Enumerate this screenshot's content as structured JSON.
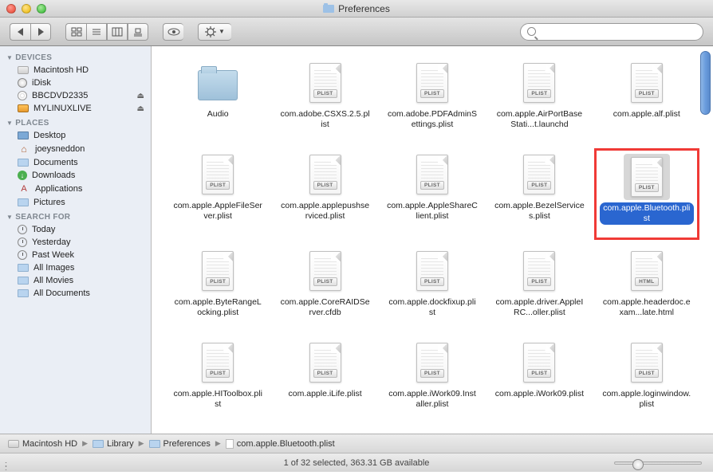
{
  "window": {
    "title": "Preferences"
  },
  "search": {
    "placeholder": ""
  },
  "sidebar": {
    "sections": [
      {
        "header": "DEVICES",
        "items": [
          {
            "label": "Macintosh HD",
            "icon": "drive",
            "eject": false
          },
          {
            "label": "iDisk",
            "icon": "idisk",
            "eject": false
          },
          {
            "label": "BBCDVD2335",
            "icon": "disc",
            "eject": true
          },
          {
            "label": "MYLINUXLIVE",
            "icon": "ext",
            "eject": true
          }
        ]
      },
      {
        "header": "PLACES",
        "items": [
          {
            "label": "Desktop",
            "icon": "desk"
          },
          {
            "label": "joeysneddon",
            "icon": "home"
          },
          {
            "label": "Documents",
            "icon": "folder"
          },
          {
            "label": "Downloads",
            "icon": "dl"
          },
          {
            "label": "Applications",
            "icon": "app"
          },
          {
            "label": "Pictures",
            "icon": "folder"
          }
        ]
      },
      {
        "header": "SEARCH FOR",
        "items": [
          {
            "label": "Today",
            "icon": "clock"
          },
          {
            "label": "Yesterday",
            "icon": "clock"
          },
          {
            "label": "Past Week",
            "icon": "clock"
          },
          {
            "label": "All Images",
            "icon": "img"
          },
          {
            "label": "All Movies",
            "icon": "img"
          },
          {
            "label": "All Documents",
            "icon": "img"
          }
        ]
      }
    ]
  },
  "files": [
    {
      "name": "Audio",
      "type": "folder",
      "badge": ""
    },
    {
      "name": "com.adobe.CSXS.2.5.plist",
      "type": "doc",
      "badge": "PLIST"
    },
    {
      "name": "com.adobe.PDFAdminSettings.plist",
      "type": "doc",
      "badge": "PLIST"
    },
    {
      "name": "com.apple.AirPortBaseStati...t.launchd",
      "type": "doc",
      "badge": "PLIST"
    },
    {
      "name": "com.apple.alf.plist",
      "type": "doc",
      "badge": "PLIST"
    },
    {
      "name": "com.apple.AppleFileServer.plist",
      "type": "doc",
      "badge": "PLIST"
    },
    {
      "name": "com.apple.applepushserviced.plist",
      "type": "doc",
      "badge": "PLIST"
    },
    {
      "name": "com.apple.AppleShareClient.plist",
      "type": "doc",
      "badge": "PLIST"
    },
    {
      "name": "com.apple.BezelServices.plist",
      "type": "doc",
      "badge": "PLIST"
    },
    {
      "name": "com.apple.Bluetooth.plist",
      "type": "doc",
      "badge": "PLIST",
      "selected": true,
      "highlight": true
    },
    {
      "name": "com.apple.ByteRangeLocking.plist",
      "type": "doc",
      "badge": "PLIST"
    },
    {
      "name": "com.apple.CoreRAIDServer.cfdb",
      "type": "doc",
      "badge": "PLIST"
    },
    {
      "name": "com.apple.dockfixup.plist",
      "type": "doc",
      "badge": "PLIST"
    },
    {
      "name": "com.apple.driver.AppleIRC...oller.plist",
      "type": "doc",
      "badge": "PLIST"
    },
    {
      "name": "com.apple.headerdoc.exam...late.html",
      "type": "doc",
      "badge": "HTML"
    },
    {
      "name": "com.apple.HIToolbox.plist",
      "type": "doc",
      "badge": "PLIST"
    },
    {
      "name": "com.apple.iLife.plist",
      "type": "doc",
      "badge": "PLIST"
    },
    {
      "name": "com.apple.iWork09.Installer.plist",
      "type": "doc",
      "badge": "PLIST"
    },
    {
      "name": "com.apple.iWork09.plist",
      "type": "doc",
      "badge": "PLIST"
    },
    {
      "name": "com.apple.loginwindow.plist",
      "type": "doc",
      "badge": "PLIST"
    }
  ],
  "path": [
    {
      "label": "Macintosh HD",
      "icon": "drive"
    },
    {
      "label": "Library",
      "icon": "fold"
    },
    {
      "label": "Preferences",
      "icon": "fold"
    },
    {
      "label": "com.apple.Bluetooth.plist",
      "icon": "docf"
    }
  ],
  "status": {
    "text": "1 of 32 selected, 363.31 GB available"
  }
}
